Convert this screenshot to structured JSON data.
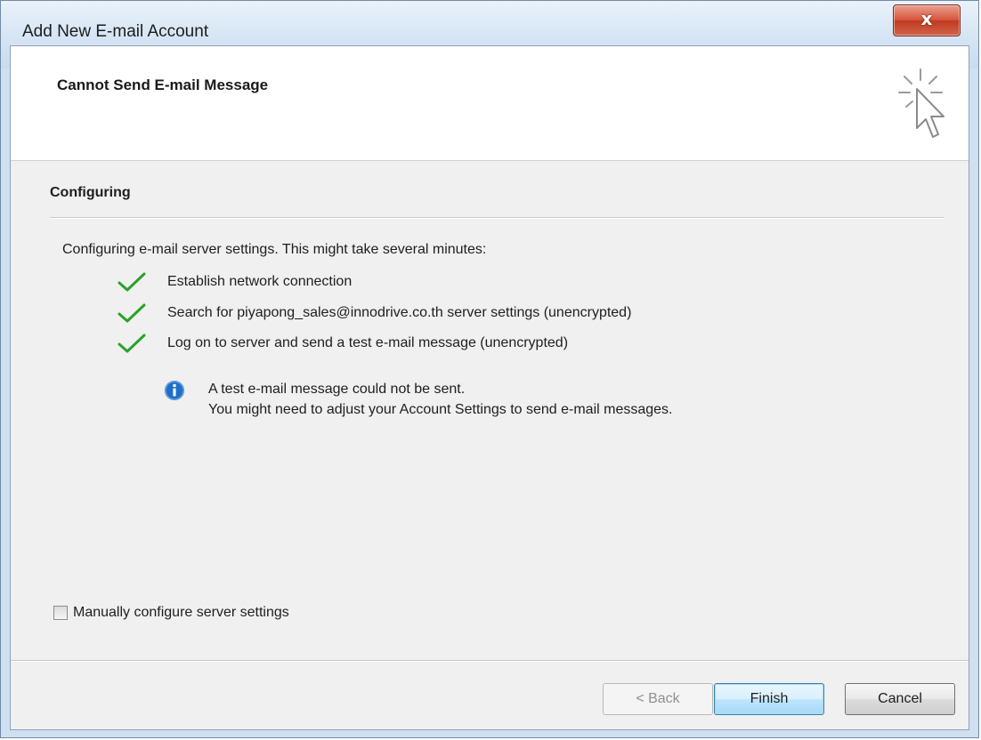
{
  "window": {
    "title": "Add New E-mail Account",
    "close_glyph": "x"
  },
  "header": {
    "title": "Cannot Send E-mail Message",
    "icon": "cursor-click-icon"
  },
  "section": {
    "title": "Configuring",
    "intro": "Configuring e-mail server settings. This might take several minutes:"
  },
  "steps": [
    {
      "status": "done",
      "icon": "checkmark-icon",
      "label": "Establish network connection"
    },
    {
      "status": "done",
      "icon": "checkmark-icon",
      "label": "Search for piyapong_sales@innodrive.co.th server settings (unencrypted)"
    },
    {
      "status": "done",
      "icon": "checkmark-icon",
      "label": "Log on to server and send a test e-mail message (unencrypted)"
    }
  ],
  "info": {
    "icon": "info-icon",
    "line1": "A test e-mail message could not be sent.",
    "line2": "You might need to adjust your Account Settings to send e-mail messages."
  },
  "options": {
    "manual_config_label": "Manually configure server settings",
    "manual_config_checked": false
  },
  "buttons": {
    "back": "< Back",
    "finish": "Finish",
    "cancel": "Cancel"
  },
  "colors": {
    "check_green": "#2aa12a",
    "info_blue": "#1f6fc9",
    "close_red": "#c8412a"
  }
}
